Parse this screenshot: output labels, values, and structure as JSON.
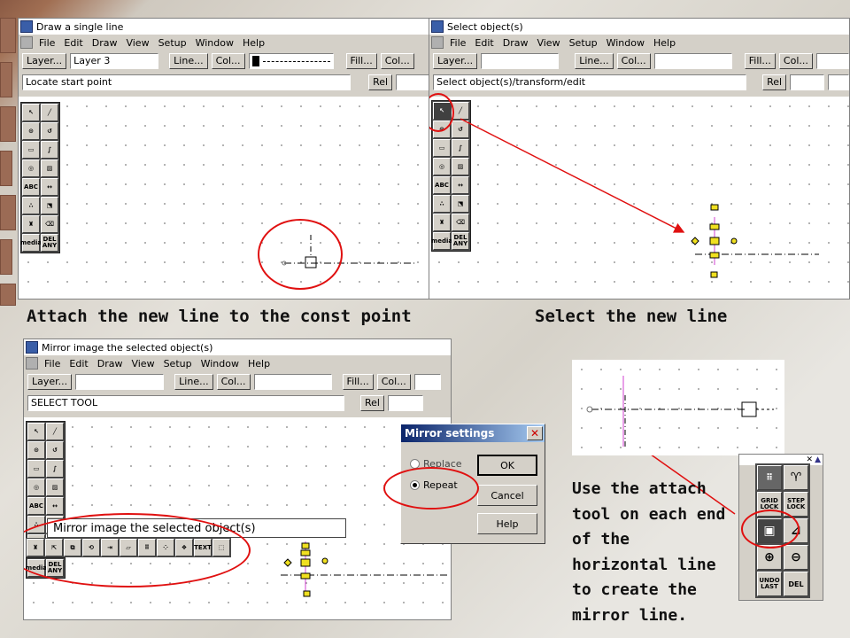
{
  "captions": {
    "top_left": "Attach the new line to the const point",
    "top_right": "Select the new line",
    "bottom_right": "Use the attach tool on each end of the horizontal line to create the mirror line."
  },
  "win1": {
    "title": "Draw a single line",
    "menu": [
      "File",
      "Edit",
      "Draw",
      "View",
      "Setup",
      "Window",
      "Help"
    ],
    "layer_btn": "Layer...",
    "layer_value": "Layer 3",
    "line_btn": "Line...",
    "col_btn": "Col...",
    "fill_btn": "Fill...",
    "col2_btn": "Col...",
    "status": "Locate start point",
    "rel_btn": "Rel"
  },
  "win2": {
    "title": "Select object(s)",
    "menu": [
      "File",
      "Edit",
      "Draw",
      "View",
      "Setup",
      "Window",
      "Help"
    ],
    "layer_btn": "Layer...",
    "line_btn": "Line...",
    "col_btn": "Col...",
    "fill_btn": "Fill...",
    "col2_btn": "Col...",
    "status": "Select object(s)/transform/edit",
    "rel_btn": "Rel"
  },
  "win3": {
    "title": "Mirror image the selected object(s)",
    "menu": [
      "File",
      "Edit",
      "Draw",
      "View",
      "Setup",
      "Window",
      "Help"
    ],
    "layer_btn": "Layer...",
    "line_btn": "Line...",
    "col_btn": "Col...",
    "fill_btn": "Fill...",
    "col2_btn": "Col...",
    "status": "SELECT TOOL",
    "rel_btn": "Rel",
    "tooltip": "Mirror image the selected object(s)"
  },
  "palette_labels": {
    "abc": "ABC",
    "media": "media",
    "del": "DEL ANY",
    "text": "TEXT"
  },
  "dialog": {
    "title": "Mirror settings",
    "option_replace": "Replace",
    "option_repeat": "Repeat",
    "selected": "Repeat",
    "ok": "OK",
    "cancel": "Cancel",
    "help": "Help"
  },
  "snap_palette": {
    "grid_lock": "GRID LOCK",
    "step_lock": "STEP LOCK",
    "undo_last": "UNDO LAST",
    "del": "DEL"
  },
  "colors": {
    "annotation_red": "#e01010",
    "selection_magenta": "#d040d0",
    "handle_yellow": "#f0e020"
  }
}
